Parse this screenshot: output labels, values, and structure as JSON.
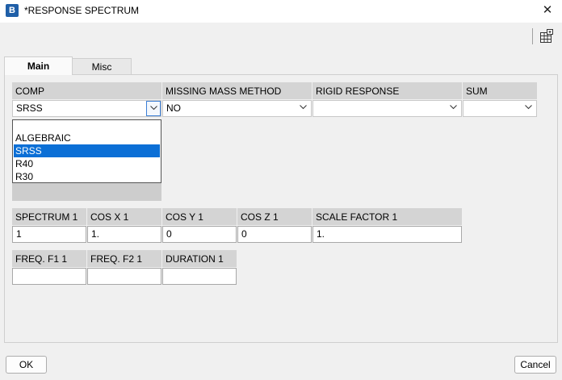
{
  "window": {
    "title": "*RESPONSE SPECTRUM",
    "app_icon": "app-logo-icon",
    "close_icon": "close-icon"
  },
  "toolbar": {
    "icon": "paste-table-icon"
  },
  "tabs": [
    {
      "label": "Main",
      "active": true
    },
    {
      "label": "Misc",
      "active": false
    }
  ],
  "row1": {
    "comp": {
      "header": "COMP",
      "value": "SRSS",
      "open": true
    },
    "missing_mass_method": {
      "header": "MISSING MASS METHOD",
      "value": "NO"
    },
    "rigid_response": {
      "header": "RIGID RESPONSE",
      "value": ""
    },
    "sum": {
      "header": "SUM",
      "value": ""
    }
  },
  "comp_dropdown": {
    "options": [
      "",
      "ALGEBRAIC",
      "SRSS",
      "R40",
      "R30"
    ],
    "selected": "SRSS",
    "selected_color": "#0b6fd6"
  },
  "row2": {
    "spectrum_1": {
      "header": "SPECTRUM 1",
      "value": "1"
    },
    "cos_x_1": {
      "header": "COS X 1",
      "value": "1."
    },
    "cos_y_1": {
      "header": "COS Y 1",
      "value": "0"
    },
    "cos_z_1": {
      "header": "COS Z 1",
      "value": "0"
    },
    "scale_factor_1": {
      "header": "SCALE FACTOR 1",
      "value": "1."
    }
  },
  "row3": {
    "freq_f1_1": {
      "header": "FREQ. F1 1",
      "value": ""
    },
    "freq_f2_1": {
      "header": "FREQ. F2 1",
      "value": ""
    },
    "duration_1": {
      "header": "DURATION 1",
      "value": ""
    }
  },
  "buttons": {
    "ok": "OK",
    "cancel": "Cancel"
  }
}
